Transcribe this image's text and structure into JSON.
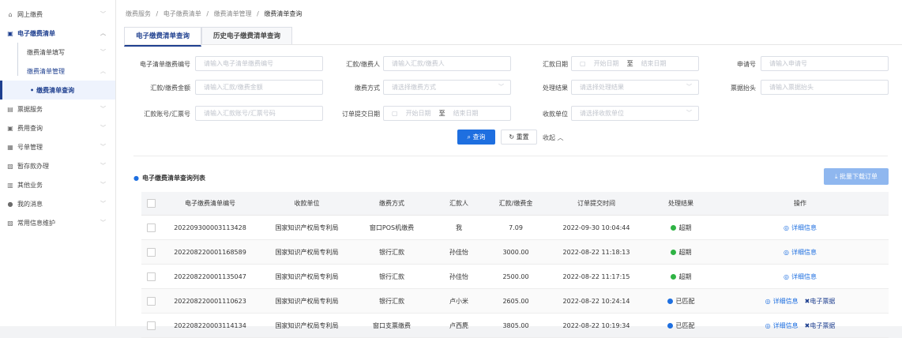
{
  "colors": {
    "accent": "#1e3f8f",
    "primary": "#1e6fe0",
    "status_overdue": "#2fb344",
    "status_matched": "#1e6fe0"
  },
  "sidebar": {
    "items": [
      {
        "icon": "bank-icon",
        "label": "网上缴费",
        "chevron": "﹀"
      },
      {
        "icon": "list-icon",
        "label": "电子缴费清单",
        "chevron": "︿"
      },
      {
        "label": "缴费清单填写",
        "chevron": "﹀"
      },
      {
        "label": "缴费清单管理",
        "chevron": "︿"
      },
      {
        "label": "缴费清单查询"
      },
      {
        "icon": "ticket-icon",
        "label": "票据服务",
        "chevron": "﹀"
      },
      {
        "icon": "fee-icon",
        "label": "费用查询",
        "chevron": "﹀"
      },
      {
        "icon": "number-icon",
        "label": "号单管理",
        "chevron": "﹀"
      },
      {
        "icon": "deposit-icon",
        "label": "暂存款办理",
        "chevron": "﹀"
      },
      {
        "icon": "other-icon",
        "label": "其他业务",
        "chevron": "﹀"
      },
      {
        "icon": "message-icon",
        "label": "我的消息",
        "chevron": "﹀"
      },
      {
        "icon": "maintain-icon",
        "label": "常用信息维护",
        "chevron": "﹀"
      }
    ]
  },
  "breadcrumb": [
    "缴费服务",
    "电子缴费清单",
    "缴费清单管理",
    "缴费清单查询"
  ],
  "breadcrumb_sep": "/",
  "tabs": [
    "电子缴费清单查询",
    "历史电子缴费清单查询"
  ],
  "form": {
    "list_no": {
      "label": "电子清单缴费编号",
      "placeholder": "请输入电子清单缴费编号"
    },
    "payer": {
      "label": "汇款/缴费人",
      "placeholder": "请输入汇款/缴费人"
    },
    "remit_date": {
      "label": "汇款日期",
      "start": "开始日期",
      "sep": "至",
      "end": "结束日期"
    },
    "applicant_no": {
      "label": "申请号",
      "placeholder": "请输入申请号"
    },
    "amount": {
      "label": "汇款/缴费金额",
      "placeholder": "请输入汇款/缴费金额"
    },
    "method": {
      "label": "缴费方式",
      "placeholder": "请选择缴费方式"
    },
    "result": {
      "label": "处理结果",
      "placeholder": "请选择处理结果"
    },
    "invoice_title": {
      "label": "票据抬头",
      "placeholder": "请输入票据抬头"
    },
    "account": {
      "label": "汇款账号/汇票号",
      "placeholder": "请输入汇款账号/汇票号码"
    },
    "submit_date": {
      "label": "订单提交日期",
      "start": "开始日期",
      "sep": "至",
      "end": "结束日期"
    },
    "receiver": {
      "label": "收款单位",
      "placeholder": "请选择收款单位"
    }
  },
  "buttons": {
    "query": "查询",
    "reset": "重置",
    "collapse": "收起"
  },
  "list_title": "电子缴费清单查询列表",
  "batch_download": "批量下载订单",
  "table": {
    "headers": [
      "电子缴费清单编号",
      "收款单位",
      "缴费方式",
      "汇款人",
      "汇款/缴费金",
      "订单提交时间",
      "处理结果",
      "操作"
    ],
    "rows": [
      {
        "id": "202209300003113428",
        "unit": "国家知识产权局专利局",
        "method": "窗口POS机缴费",
        "payer": "我",
        "amount": "7.09",
        "time": "2022-09-30 10:04:44",
        "status": "超期",
        "status_color": "#2fb344",
        "ops": [
          "详细信息"
        ]
      },
      {
        "id": "202208220001168589",
        "unit": "国家知识产权局专利局",
        "method": "银行汇款",
        "payer": "孙佳怡",
        "amount": "3000.00",
        "time": "2022-08-22 11:18:13",
        "status": "超期",
        "status_color": "#2fb344",
        "ops": [
          "详细信息"
        ]
      },
      {
        "id": "202208220001135047",
        "unit": "国家知识产权局专利局",
        "method": "银行汇款",
        "payer": "孙佳怡",
        "amount": "2500.00",
        "time": "2022-08-22 11:17:15",
        "status": "超期",
        "status_color": "#2fb344",
        "ops": [
          "详细信息"
        ]
      },
      {
        "id": "202208220001110623",
        "unit": "国家知识产权局专利局",
        "method": "银行汇款",
        "payer": "卢小米",
        "amount": "2605.00",
        "time": "2022-08-22 10:24:14",
        "status": "已匹配",
        "status_color": "#1e6fe0",
        "ops": [
          "详细信息",
          "电子票据"
        ]
      },
      {
        "id": "202208220003114134",
        "unit": "国家知识产权局专利局",
        "method": "窗口支票缴费",
        "payer": "卢西麂",
        "amount": "3805.00",
        "time": "2022-08-22 10:19:34",
        "status": "已匹配",
        "status_color": "#1e6fe0",
        "ops": [
          "详细信息",
          "电子票据"
        ]
      }
    ]
  }
}
